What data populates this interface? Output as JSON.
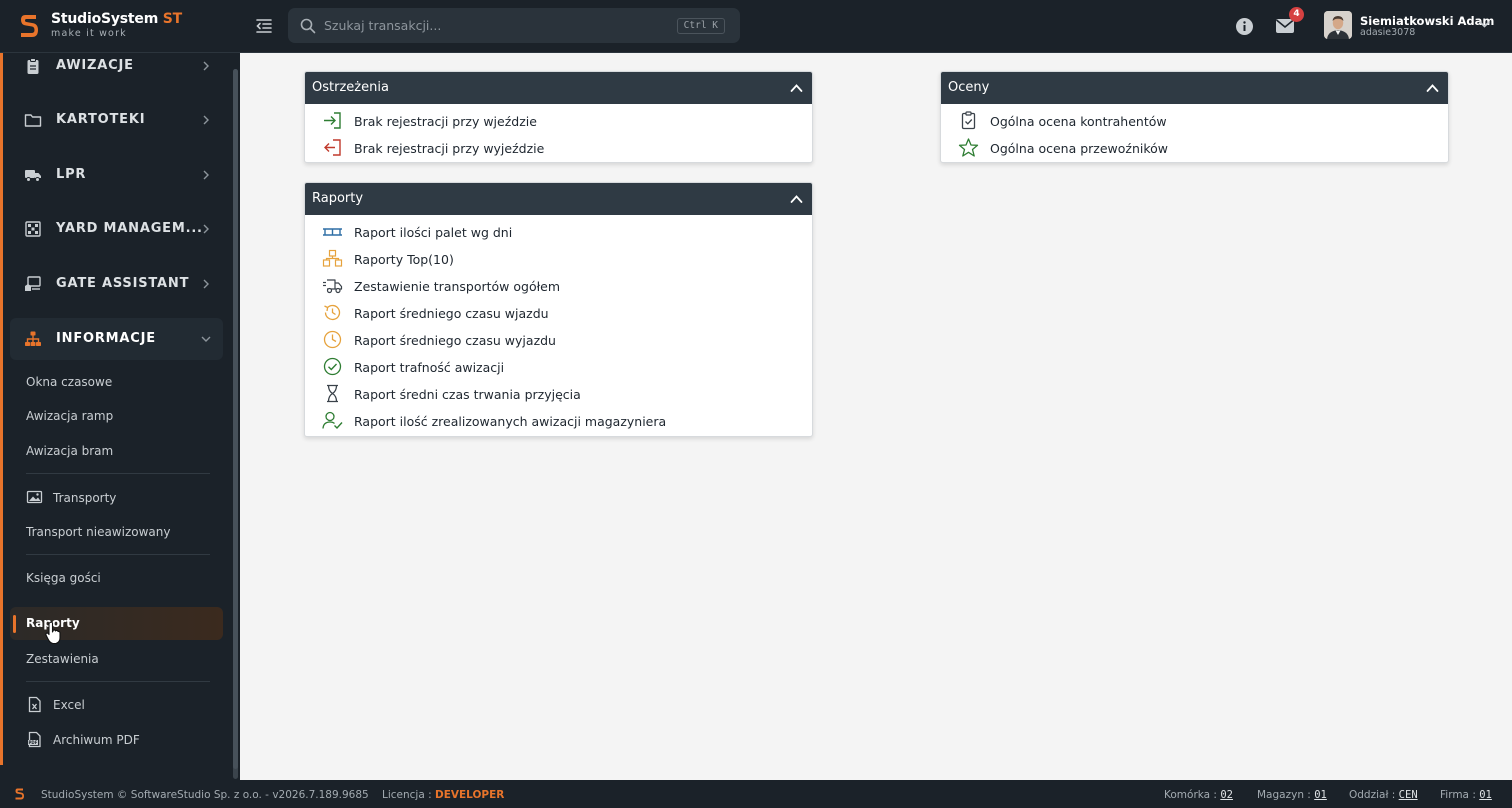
{
  "app": {
    "brand": "StudioSystem",
    "brand_suffix": "ST",
    "tagline": "make it work"
  },
  "search": {
    "placeholder": "Szukaj transakcji...",
    "shortcut": "Ctrl K"
  },
  "header": {
    "notifications_count": "4",
    "user_name": "Siemiatkowski Adam",
    "user_login": "adasie3078"
  },
  "sidebar": {
    "groups": [
      {
        "label": "AWIZACJE",
        "icon": "clipboard-icon"
      },
      {
        "label": "KARTOTEKI",
        "icon": "folder-icon"
      },
      {
        "label": "LPR",
        "icon": "truck-icon"
      },
      {
        "label": "YARD MANAGEM...",
        "icon": "grid-icon"
      },
      {
        "label": "GATE ASSISTANT",
        "icon": "kiosk-icon"
      },
      {
        "label": "INFORMACJE",
        "icon": "sitemap-icon"
      }
    ],
    "subitems": [
      {
        "label": "Okna czasowe"
      },
      {
        "label": "Awizacja ramp"
      },
      {
        "label": "Awizacja bram"
      },
      {
        "label": "Transporty",
        "icon": "image-icon"
      },
      {
        "label": "Transport nieawizowany"
      },
      {
        "label": "Księga gości"
      },
      {
        "label": "Raporty"
      },
      {
        "label": "Zestawienia"
      },
      {
        "label": "Excel",
        "icon": "excel-icon"
      },
      {
        "label": "Archiwum PDF",
        "icon": "pdf-icon"
      }
    ]
  },
  "panels": {
    "warnings": {
      "title": "Ostrzeżenia",
      "items": [
        {
          "label": "Brak rejestracji przy wjeździe",
          "icon": "sign-in-icon"
        },
        {
          "label": "Brak rejestracji przy wyjeździe",
          "icon": "sign-out-icon"
        }
      ]
    },
    "ratings": {
      "title": "Oceny",
      "items": [
        {
          "label": "Ogólna ocena kontrahentów",
          "icon": "clipboard-check-icon"
        },
        {
          "label": "Ogólna ocena przewoźników",
          "icon": "star-icon"
        }
      ]
    },
    "reports": {
      "title": "Raporty",
      "items": [
        {
          "label": "Raport ilości palet wg dni",
          "icon": "pallet-icon"
        },
        {
          "label": "Raporty Top(10)",
          "icon": "boxes-icon"
        },
        {
          "label": "Zestawienie transportów ogółem",
          "icon": "truck-fast-icon"
        },
        {
          "label": "Raport średniego czasu wjazdu",
          "icon": "history-icon"
        },
        {
          "label": "Raport średniego czasu wyjazdu",
          "icon": "clock-icon"
        },
        {
          "label": "Raport trafność awizacji",
          "icon": "check-circle-icon"
        },
        {
          "label": "Raport średni czas trwania przyjęcia",
          "icon": "hourglass-icon"
        },
        {
          "label": "Raport ilość zrealizowanych awizacji magazyniera",
          "icon": "user-check-icon"
        }
      ]
    }
  },
  "footer": {
    "copyright": "StudioSystem © SoftwareStudio Sp. z o.o. - v2026.7.189.9685",
    "license_label": "Licencja :",
    "license_value": "DEVELOPER",
    "komorka_label": "Komórka :",
    "komorka_value": "02",
    "magazyn_label": "Magazyn :",
    "magazyn_value": "01",
    "oddzial_label": "Oddział :",
    "oddzial_value": "CEN",
    "firma_label": "Firma :",
    "firma_value": "01"
  },
  "colors": {
    "accent": "#e8742b",
    "sidebar_bg": "#1b2229",
    "panel_header": "#2f3a44",
    "icon_green": "#2e7d32",
    "icon_red": "#c0392b",
    "icon_orange": "#e6a23c",
    "icon_blue": "#2f6fa5",
    "badge": "#d64141"
  }
}
